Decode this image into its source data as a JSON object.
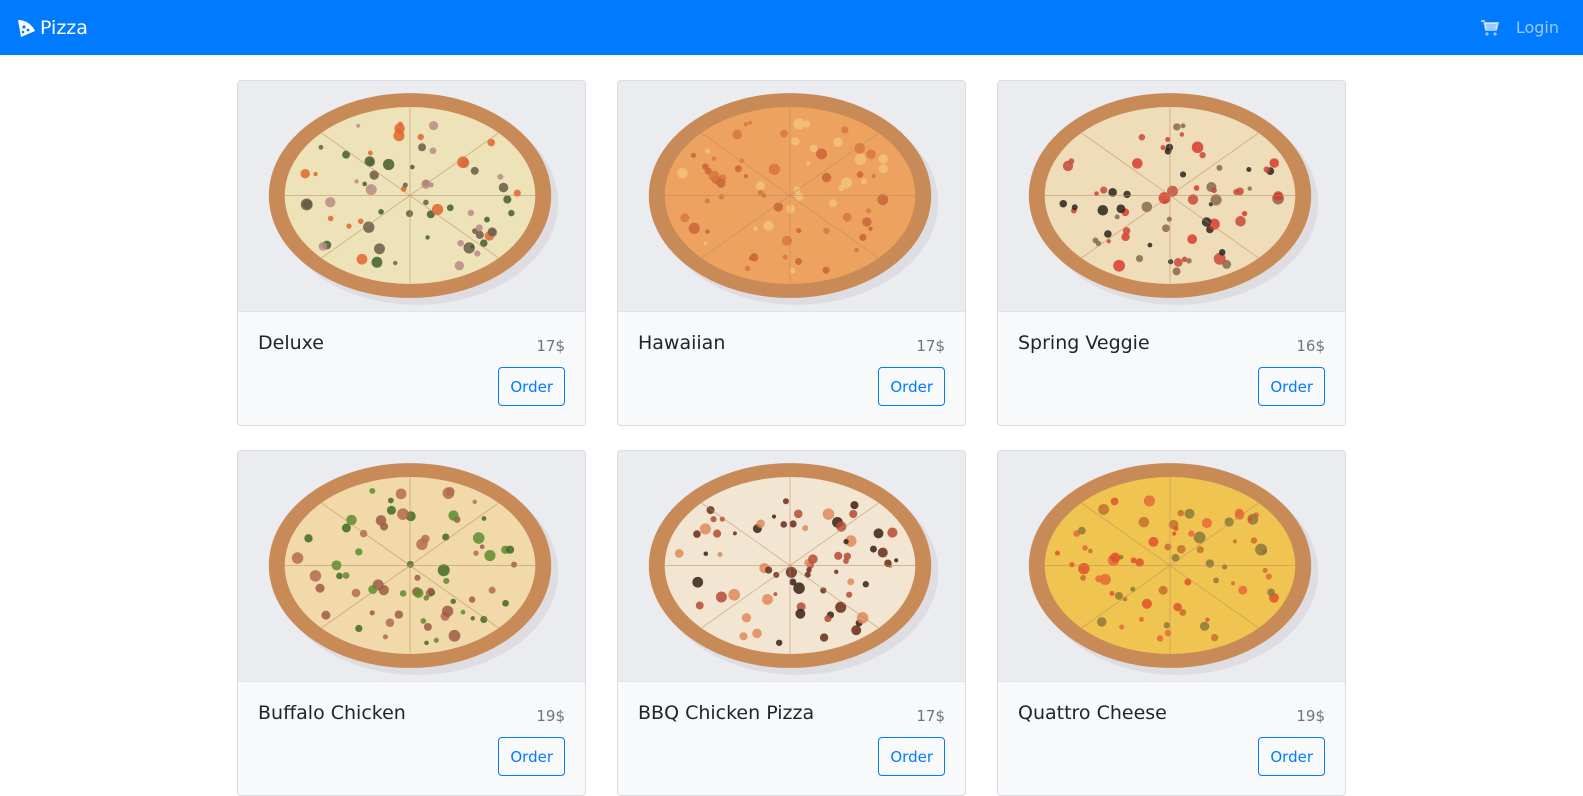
{
  "navbar": {
    "brand": "Pizza",
    "login_label": "Login",
    "color": "#007bff"
  },
  "products": [
    {
      "name": "Deluxe",
      "price": "17$",
      "order_label": "Order",
      "topping": "deluxe"
    },
    {
      "name": "Hawaiian",
      "price": "17$",
      "order_label": "Order",
      "topping": "hawaiian"
    },
    {
      "name": "Spring Veggie",
      "price": "16$",
      "order_label": "Order",
      "topping": "veggie"
    },
    {
      "name": "Buffalo Chicken",
      "price": "19$",
      "order_label": "Order",
      "topping": "buffalo"
    },
    {
      "name": "BBQ Chicken Pizza",
      "price": "17$",
      "order_label": "Order",
      "topping": "bbq"
    },
    {
      "name": "Quattro Cheese",
      "price": "19$",
      "order_label": "Order",
      "topping": "quattro"
    }
  ],
  "icons": {
    "brand": "pizza-slice-icon",
    "cart": "shopping-cart-icon"
  }
}
